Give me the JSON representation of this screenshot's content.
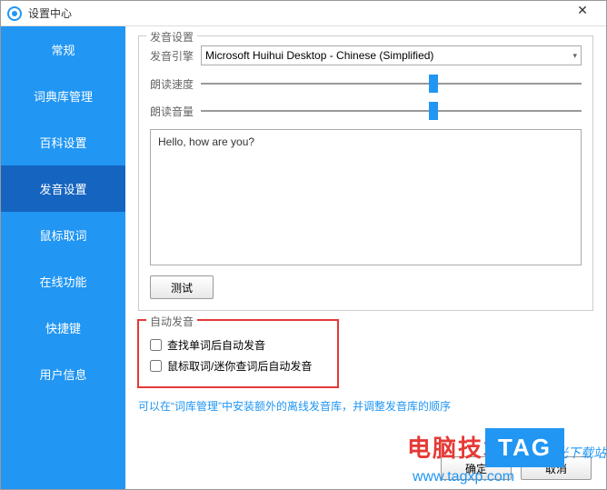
{
  "window": {
    "title": "设置中心"
  },
  "sidebar": {
    "items": [
      {
        "label": "常规"
      },
      {
        "label": "词典库管理"
      },
      {
        "label": "百科设置"
      },
      {
        "label": "发音设置"
      },
      {
        "label": "鼠标取词"
      },
      {
        "label": "在线功能"
      },
      {
        "label": "快捷键"
      },
      {
        "label": "用户信息"
      }
    ]
  },
  "voice": {
    "legend": "发音设置",
    "engine_label": "发音引擎",
    "engine_value": "Microsoft Huihui Desktop - Chinese (Simplified)",
    "speed_label": "朗读速度",
    "volume_label": "朗读音量",
    "sample_text": "Hello, how are you?",
    "test_label": "测试"
  },
  "auto": {
    "legend": "自动发音",
    "opt1": "查找单词后自动发音",
    "opt2": "鼠标取词/迷你查词后自动发音"
  },
  "hint": "可以在“词库管理”中安装额外的离线发音库，并调整发音库的顺序",
  "footer": {
    "ok": "确定",
    "cancel": "取消"
  },
  "watermark": {
    "site_cn": "电脑技术网",
    "site_url": "www.tagxp.com",
    "tag": "TAG",
    "side": "光下载站"
  }
}
